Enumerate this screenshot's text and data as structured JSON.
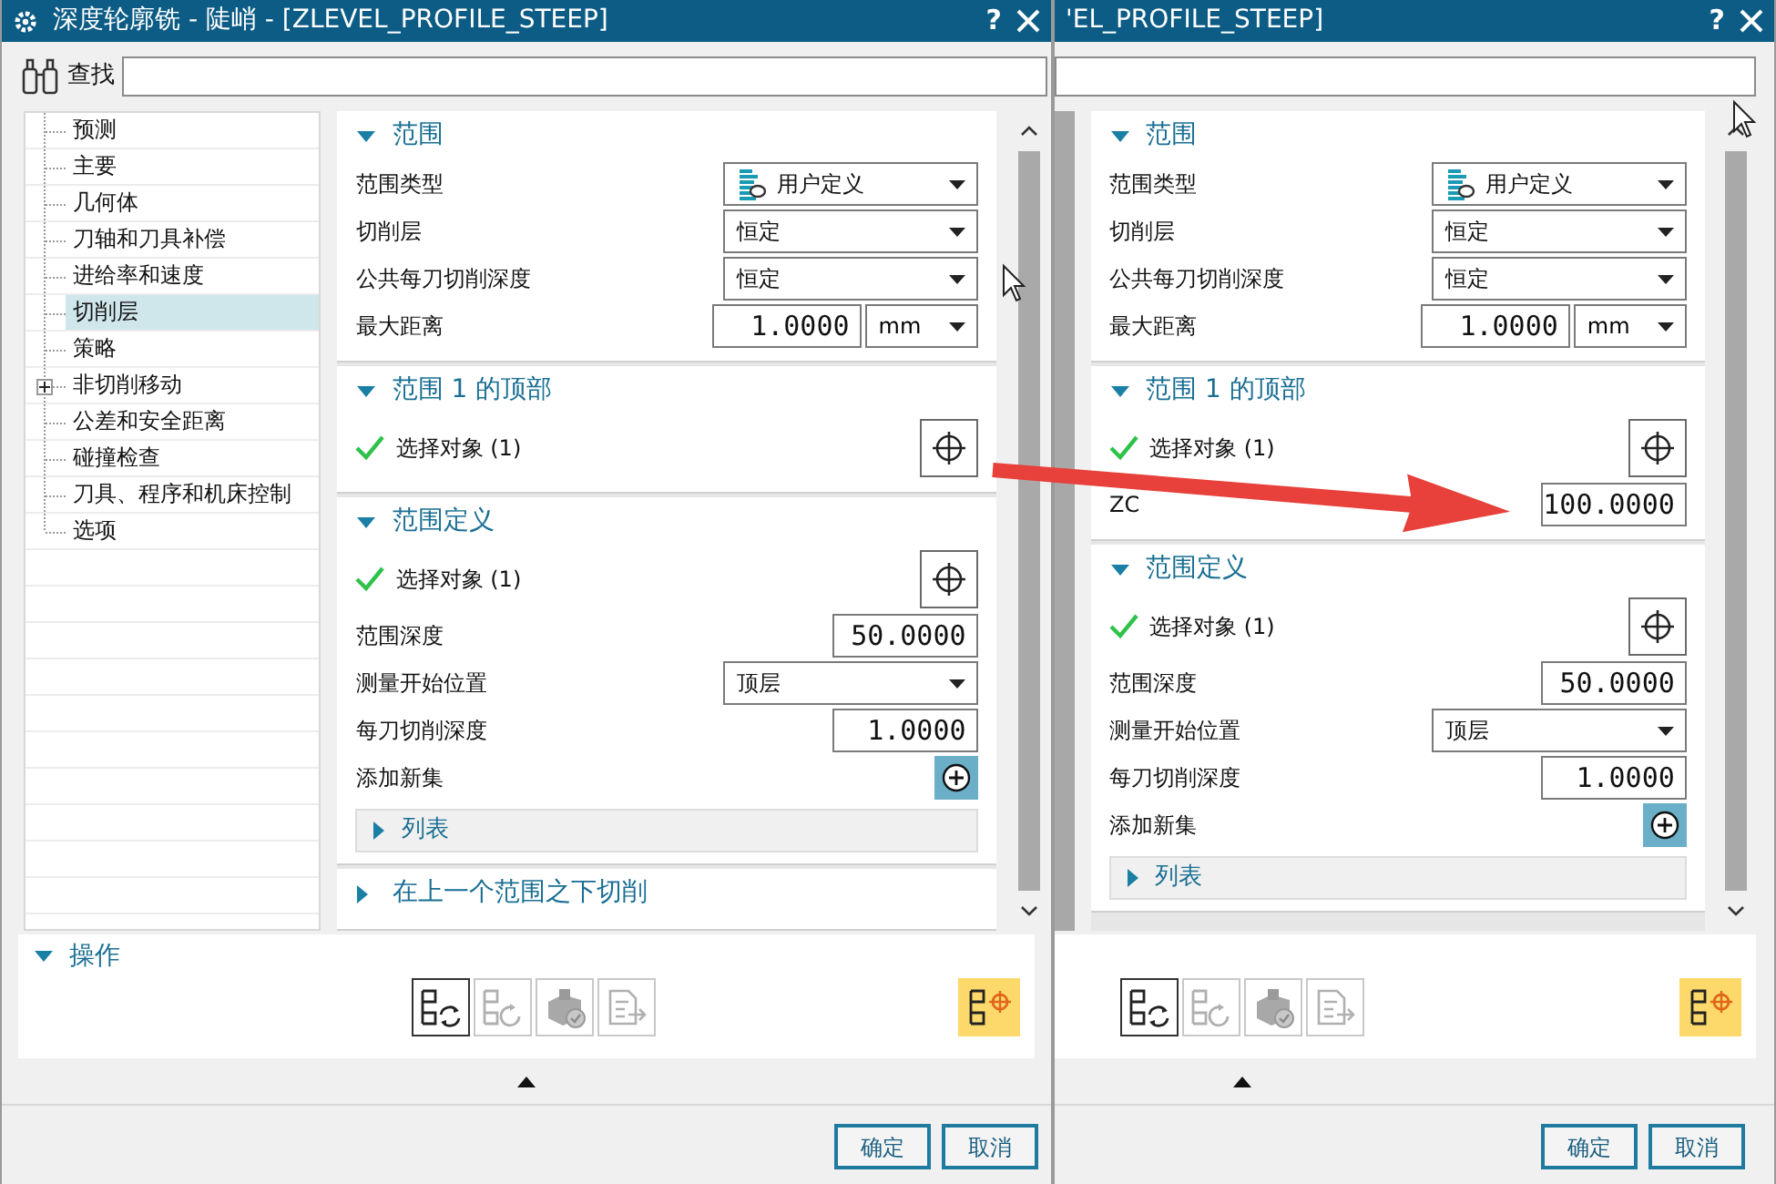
{
  "dialogs": [
    {
      "title": "深度轮廓铣 - 陡峭 - [ZLEVEL_PROFILE_STEEP]",
      "help": "?",
      "search": {
        "label": "查找"
      },
      "tree": [
        {
          "label": "预测",
          "selected": false,
          "has_children": false
        },
        {
          "label": "主要",
          "selected": false,
          "has_children": false
        },
        {
          "label": "几何体",
          "selected": false,
          "has_children": false
        },
        {
          "label": "刀轴和刀具补偿",
          "selected": false,
          "has_children": false
        },
        {
          "label": "进给率和速度",
          "selected": false,
          "has_children": false
        },
        {
          "label": "切削层",
          "selected": true,
          "has_children": false
        },
        {
          "label": "策略",
          "selected": false,
          "has_children": false
        },
        {
          "label": "非切削移动",
          "selected": false,
          "has_children": true
        },
        {
          "label": "公差和安全距离",
          "selected": false,
          "has_children": false
        },
        {
          "label": "碰撞检查",
          "selected": false,
          "has_children": false
        },
        {
          "label": "刀具、程序和机床控制",
          "selected": false,
          "has_children": false
        },
        {
          "label": "选项",
          "selected": false,
          "has_children": false
        }
      ],
      "sections": [
        {
          "title": "范围",
          "expanded": true,
          "rows": [
            {
              "kind": "dropdown_icon",
              "label": "范围类型",
              "value": "用户定义"
            },
            {
              "kind": "dropdown",
              "label": "切削层",
              "value": "恒定"
            },
            {
              "kind": "dropdown",
              "label": "公共每刀切削深度",
              "value": "恒定"
            },
            {
              "kind": "number_unit",
              "label": "最大距离",
              "value": "1.0000",
              "unit": "mm"
            }
          ]
        },
        {
          "title": "范围 1 的顶部",
          "expanded": true,
          "rows": [
            {
              "kind": "select",
              "label": "选择对象 (1)"
            }
          ]
        },
        {
          "title": "范围定义",
          "expanded": true,
          "rows": [
            {
              "kind": "select",
              "label": "选择对象 (1)"
            },
            {
              "kind": "number",
              "label": "范围深度",
              "value": "50.0000"
            },
            {
              "kind": "dropdown",
              "label": "测量开始位置",
              "value": "顶层"
            },
            {
              "kind": "number",
              "label": "每刀切削深度",
              "value": "1.0000"
            },
            {
              "kind": "add",
              "label": "添加新集"
            },
            {
              "kind": "sublist",
              "label": "列表",
              "expanded": false
            }
          ]
        },
        {
          "title": "在上一个范围之下切削",
          "expanded": false
        }
      ],
      "operations": {
        "title": "操作",
        "expanded": true,
        "buttons": [
          {
            "kind": "regenerate",
            "disabled": false,
            "highlighted": false
          },
          {
            "kind": "replay",
            "disabled": true,
            "highlighted": false
          },
          {
            "kind": "verify",
            "disabled": true,
            "highlighted": false
          },
          {
            "kind": "list",
            "disabled": true,
            "highlighted": false
          },
          {
            "kind": "path",
            "disabled": false,
            "highlighted": true
          }
        ]
      },
      "buttons": [
        "确定",
        "取消"
      ]
    },
    {
      "title": "'EL_PROFILE_STEEP]",
      "help": "?",
      "sections": [
        {
          "title": "范围",
          "expanded": true,
          "rows": [
            {
              "kind": "dropdown_icon",
              "label": "范围类型",
              "value": "用户定义"
            },
            {
              "kind": "dropdown",
              "label": "切削层",
              "value": "恒定"
            },
            {
              "kind": "dropdown",
              "label": "公共每刀切削深度",
              "value": "恒定"
            },
            {
              "kind": "number_unit",
              "label": "最大距离",
              "value": "1.0000",
              "unit": "mm"
            }
          ]
        },
        {
          "title": "范围 1 的顶部",
          "expanded": true,
          "rows": [
            {
              "kind": "select",
              "label": "选择对象 (1)"
            },
            {
              "kind": "number",
              "label": "ZC",
              "value": "100.0000"
            }
          ]
        },
        {
          "title": "范围定义",
          "expanded": true,
          "rows": [
            {
              "kind": "select",
              "label": "选择对象 (1)"
            },
            {
              "kind": "number",
              "label": "范围深度",
              "value": "50.0000"
            },
            {
              "kind": "dropdown",
              "label": "测量开始位置",
              "value": "顶层"
            },
            {
              "kind": "number",
              "label": "每刀切削深度",
              "value": "1.0000"
            },
            {
              "kind": "add",
              "label": "添加新集"
            },
            {
              "kind": "sublist",
              "label": "列表",
              "expanded": false
            }
          ]
        }
      ],
      "operations": {
        "buttons": [
          {
            "kind": "regenerate",
            "disabled": false,
            "highlighted": false
          },
          {
            "kind": "replay",
            "disabled": true,
            "highlighted": false
          },
          {
            "kind": "verify",
            "disabled": true,
            "highlighted": false
          },
          {
            "kind": "list",
            "disabled": true,
            "highlighted": false
          },
          {
            "kind": "path",
            "disabled": false,
            "highlighted": true
          }
        ]
      },
      "buttons": [
        "确定",
        "取消"
      ]
    }
  ]
}
